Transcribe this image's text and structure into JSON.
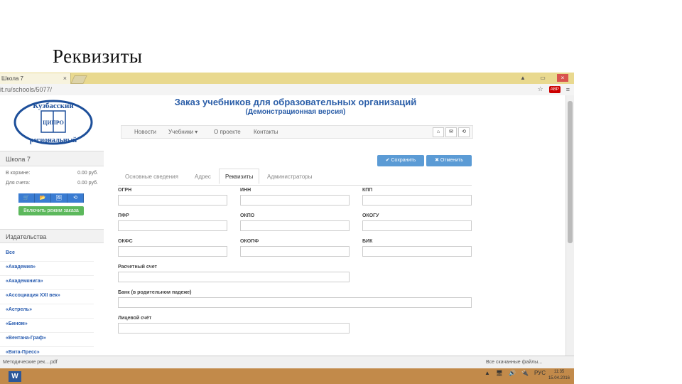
{
  "slide": {
    "title": "Реквизиты"
  },
  "browser": {
    "tab_title": "Школа 7",
    "tab_close": "×",
    "url": "it.ru/schools/5077/",
    "abp_badge": "ABP",
    "min": "▲",
    "max": "▭",
    "close": "×"
  },
  "sidebar": {
    "logo_text_top": "Кузбасский",
    "logo_text_bottom": "региональный",
    "logo_center": "ЦИПРО",
    "school_header": "Школа 7",
    "cart_label": "В корзине:",
    "cart_value": "0.00 руб.",
    "invoice_label": "Для счета:",
    "invoice_value": "0.00 руб.",
    "icon_buttons": [
      "🛒",
      "📂",
      "🖼",
      "⟲"
    ],
    "order_mode_button": "Включить режим заказа",
    "publishers_header": "Издательства",
    "publishers": [
      "Все",
      "«Академия»",
      "«Академкнига»",
      "«Ассоциация XXI век»",
      "«Астрель»",
      "«Бином»",
      "«Вентана-Граф»",
      "«Вита-Пресс»"
    ]
  },
  "main": {
    "title": "Заказ учебников для образовательных организаций",
    "subtitle": "(Демонстрационная версия)",
    "nav": [
      "Новости",
      "Учебники ▾",
      "О проекте",
      "Контакты"
    ],
    "nav_icons": [
      "⌂",
      "✉",
      "⟲"
    ],
    "save_button": "✔ Сохранить",
    "cancel_button": "✖ Отменить",
    "tabs": [
      "Основные сведения",
      "Адрес",
      "Реквизиты",
      "Администраторы"
    ],
    "fields": {
      "ogrn": "ОГРН",
      "inn": "ИНН",
      "kpp": "КПП",
      "pfr": "ПФР",
      "okpo": "ОКПО",
      "okogu": "ОКОГУ",
      "okfs": "ОКФС",
      "okopf": "ОКОПФ",
      "bik": "БИК",
      "account": "Расчетный счет",
      "bank": "Банк (в родительном падеже)",
      "personal_account": "Лицевой счёт"
    }
  },
  "downloads": {
    "item": "Методические рек....pdf",
    "right": "Все скачанные файлы..."
  },
  "taskbar": {
    "word": "W",
    "tray": [
      "▲",
      "🖥",
      "🔊",
      "🔌",
      "РУС"
    ],
    "time": "11:35",
    "date": "15.04.2016"
  },
  "colors": {
    "accent": "#2b5ea8",
    "button": "#5b9bd5",
    "green": "#5cb85c",
    "taskbar": "#c28a4a"
  }
}
